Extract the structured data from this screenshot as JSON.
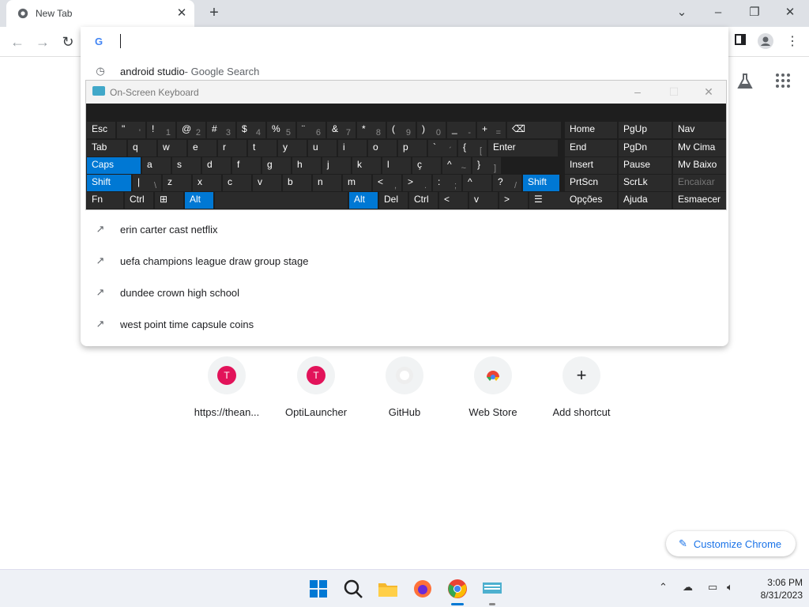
{
  "browser": {
    "tab_title": "New Tab",
    "omnibox_value": "",
    "suggestions": [
      {
        "text": "android studio",
        "suffix": " - Google Search",
        "icon": "history-icon"
      },
      {
        "text": "erin carter cast netflix",
        "icon": "trending-icon"
      },
      {
        "text": "uefa champions league draw group stage",
        "icon": "trending-icon"
      },
      {
        "text": "dundee crown high school",
        "icon": "trending-icon"
      },
      {
        "text": "west point time capsule coins",
        "icon": "trending-icon"
      }
    ]
  },
  "osk": {
    "title": "On-Screen Keyboard",
    "rows": [
      [
        [
          "Esc",
          ""
        ],
        [
          "\"",
          "'"
        ],
        [
          "!",
          "1"
        ],
        [
          "@",
          "2"
        ],
        [
          "#",
          "3"
        ],
        [
          "$",
          "4"
        ],
        [
          "%",
          "5"
        ],
        [
          "¨",
          "6"
        ],
        [
          "&",
          "7"
        ],
        [
          "*",
          "8"
        ],
        [
          "(",
          "9"
        ],
        [
          ")",
          "0"
        ],
        [
          "_",
          "-"
        ],
        [
          "+",
          "="
        ],
        [
          "⌫",
          ""
        ]
      ],
      [
        [
          "Tab",
          ""
        ],
        [
          "q",
          ""
        ],
        [
          "w",
          ""
        ],
        [
          "e",
          ""
        ],
        [
          "r",
          ""
        ],
        [
          "t",
          ""
        ],
        [
          "y",
          ""
        ],
        [
          "u",
          ""
        ],
        [
          "i",
          ""
        ],
        [
          "o",
          ""
        ],
        [
          "p",
          ""
        ],
        [
          "`",
          "´"
        ],
        [
          "{",
          "["
        ],
        [
          "Enter",
          ""
        ]
      ],
      [
        [
          "Caps",
          ""
        ],
        [
          "a",
          ""
        ],
        [
          "s",
          ""
        ],
        [
          "d",
          ""
        ],
        [
          "f",
          ""
        ],
        [
          "g",
          ""
        ],
        [
          "h",
          ""
        ],
        [
          "j",
          ""
        ],
        [
          "k",
          ""
        ],
        [
          "l",
          ""
        ],
        [
          "ç",
          ""
        ],
        [
          "^",
          "~"
        ],
        [
          "}",
          "]"
        ]
      ],
      [
        [
          "Shift",
          ""
        ],
        [
          "|",
          "\\"
        ],
        [
          "z",
          ""
        ],
        [
          "x",
          ""
        ],
        [
          "c",
          ""
        ],
        [
          "v",
          ""
        ],
        [
          "b",
          ""
        ],
        [
          "n",
          ""
        ],
        [
          "m",
          ""
        ],
        [
          "<",
          ","
        ],
        [
          ">",
          "."
        ],
        [
          ":",
          ";"
        ],
        [
          "^",
          ""
        ],
        [
          "?",
          "/"
        ],
        [
          "Shift",
          ""
        ]
      ],
      [
        [
          "Fn",
          ""
        ],
        [
          "Ctrl",
          ""
        ],
        [
          "⊞",
          ""
        ],
        [
          "Alt",
          ""
        ],
        [
          "",
          ""
        ],
        [
          "Alt",
          ""
        ],
        [
          "Del",
          ""
        ],
        [
          "Ctrl",
          ""
        ],
        [
          "<",
          ""
        ],
        [
          "v",
          ""
        ],
        [
          ">",
          ""
        ],
        [
          "☰",
          ""
        ]
      ]
    ],
    "nav": [
      [
        "Home",
        "PgUp",
        "Nav"
      ],
      [
        "End",
        "PgDn",
        "Mv Cima"
      ],
      [
        "Insert",
        "Pause",
        "Mv Baixo"
      ],
      [
        "PrtScn",
        "ScrLk",
        "Encaixar"
      ],
      [
        "Opções",
        "Ajuda",
        "Esmaecer"
      ]
    ]
  },
  "shortcuts": [
    {
      "label": "https://thean...",
      "letter": "T"
    },
    {
      "label": "OptiLauncher",
      "letter": "T"
    },
    {
      "label": "GitHub",
      "letter": ""
    },
    {
      "label": "Web Store",
      "letter": ""
    },
    {
      "label": "Add shortcut",
      "letter": "+"
    }
  ],
  "customize_label": "Customize Chrome",
  "clock": {
    "time": "3:06 PM",
    "date": "8/31/2023"
  }
}
